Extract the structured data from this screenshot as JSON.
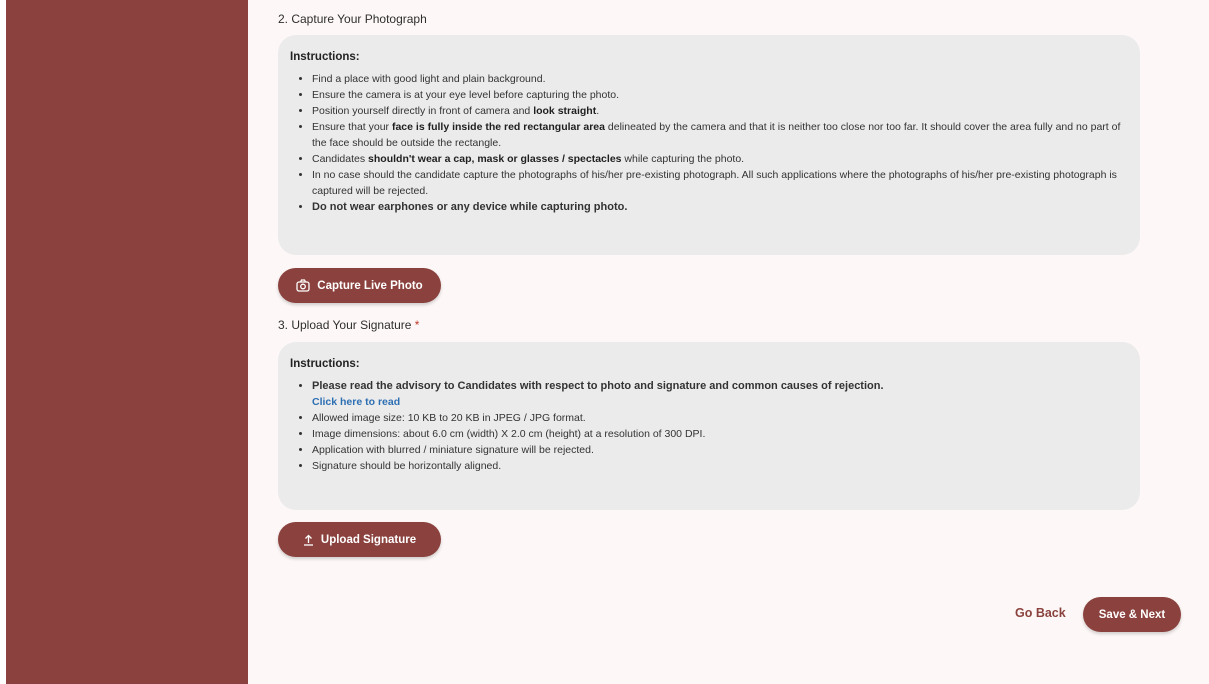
{
  "photo_section": {
    "title": "2. Capture Your Photograph",
    "instructions_heading": "Instructions:",
    "items": [
      {
        "pre": "Find a place with good light and plain background.",
        "bold": "",
        "post": ""
      },
      {
        "pre": "Ensure the camera is at your eye level before capturing the photo.",
        "bold": "",
        "post": ""
      },
      {
        "pre": "Position yourself directly in front of camera and ",
        "bold": "look straight",
        "post": "."
      },
      {
        "pre": "Ensure that your ",
        "bold": "face is fully inside the red rectangular area",
        "post": " delineated by the camera and that it is neither too close nor too far. It should cover the area fully and no part of the face should be outside the rectangle."
      },
      {
        "pre": "Candidates ",
        "bold": "shouldn't wear a cap, mask or glasses / spectacles",
        "post": " while capturing the photo."
      },
      {
        "pre": "In no case should the candidate capture the photographs of his/her pre-existing photograph. All such applications where the photographs of his/her pre-existing photograph is captured will be rejected.",
        "bold": "",
        "post": ""
      },
      {
        "pre": "",
        "bold": "Do not wear earphones or any device while capturing photo.",
        "post": ""
      }
    ],
    "button_label": "Capture Live Photo",
    "button_icon": "camera-icon"
  },
  "signature_section": {
    "title": "3. Upload Your Signature",
    "required_mark": "*",
    "instructions_heading": "Instructions:",
    "advisory": "Please read the advisory to Candidates with respect to photo and signature and common causes of rejection.",
    "advisory_link": "Click here to read",
    "items": [
      "Allowed image size: 10 KB to 20 KB in JPEG / JPG format.",
      "Image dimensions: about 6.0 cm (width) X 2.0 cm (height) at a resolution of 300 DPI.",
      "Application with blurred / miniature signature will be rejected.",
      "Signature should be horizontally aligned."
    ],
    "button_label": "Upload Signature",
    "button_icon": "upload-icon"
  },
  "footer": {
    "go_back_label": "Go Back",
    "save_next_label": "Save & Next"
  },
  "colors": {
    "primary": "#8b423e",
    "panel_bg": "#ebebeb",
    "link": "#2d6fb3"
  }
}
